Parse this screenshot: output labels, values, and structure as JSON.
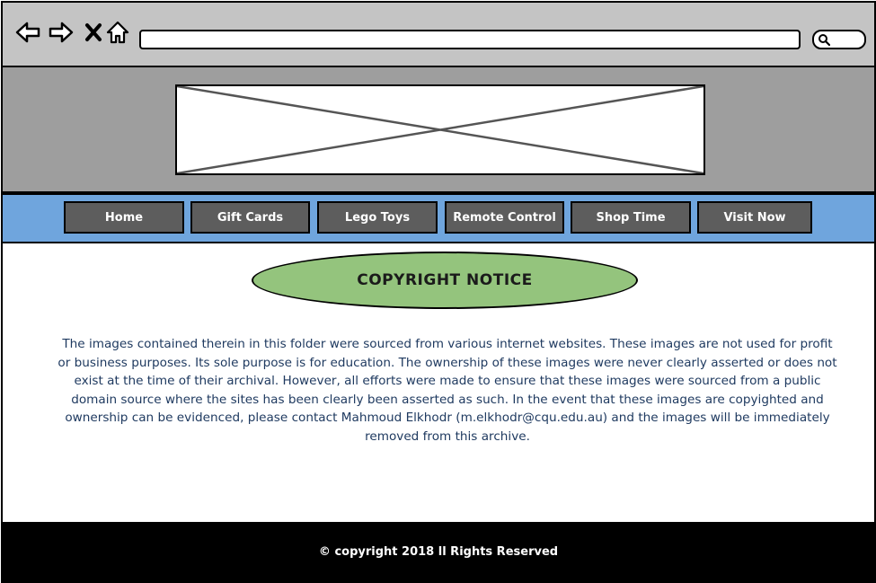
{
  "browser": {
    "icons": [
      "back-arrow-icon",
      "forward-arrow-icon",
      "close-icon",
      "home-icon",
      "search-icon"
    ],
    "address_value": "",
    "search_value": ""
  },
  "header": {
    "banner": "image-placeholder"
  },
  "nav": {
    "items": [
      {
        "label": "Home"
      },
      {
        "label": "Gift Cards"
      },
      {
        "label": "Lego Toys"
      },
      {
        "label": "Remote Control"
      },
      {
        "label": "Shop Time"
      },
      {
        "label": "Visit Now"
      }
    ]
  },
  "main": {
    "title": "COPYRIGHT NOTICE",
    "notice": "The images contained therein in this folder were sourced from various internet websites. These images are not used for profit or business purposes. Its sole purpose is for education. The ownership of these images were never clearly asserted or does not exist at the time of their archival. However, all efforts were made to ensure that these images were sourced from a public domain source where the sites has been clearly been asserted as such. In the event that these images are copyighted and ownership can be evidenced, please contact Mahmoud Elkhodr (m.elkhodr@cqu.edu.au) and the images will be immediately removed from this archive."
  },
  "footer": {
    "text": "© copyright 2018 ll Rights Reserved"
  },
  "colors": {
    "chrome": "#c4c4c4",
    "header": "#9e9e9e",
    "nav_bar": "#6fa5dd",
    "nav_button": "#5d5d5d",
    "title_oval": "#94c47d",
    "notice_text": "#1f3a60",
    "footer": "#000000"
  }
}
